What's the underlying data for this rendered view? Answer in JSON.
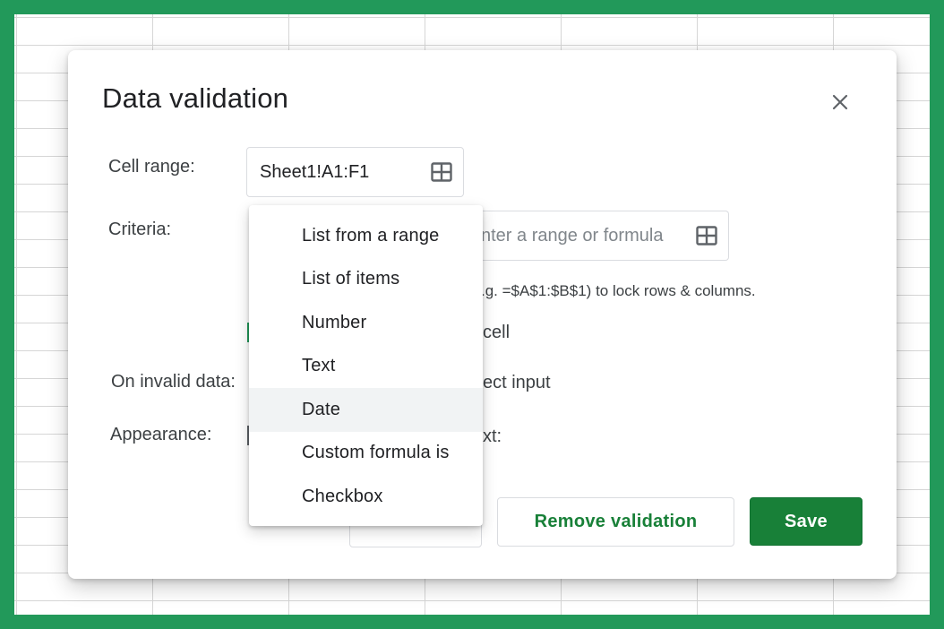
{
  "dialog": {
    "title": "Data validation",
    "close_icon": "close-icon"
  },
  "cell_range": {
    "label": "Cell range:",
    "value": "Sheet1!A1:F1",
    "icon": "grid-select-icon"
  },
  "criteria": {
    "label": "Criteria:",
    "placeholder_visible": "nter a range or formula",
    "icon": "grid-select-icon",
    "hint_visible": ".g. =$A$1:$B$1) to lock rows & columns.",
    "checkbox_text_visible": "cell"
  },
  "on_invalid": {
    "label": "On invalid data:",
    "option_text_visible": "ect input"
  },
  "appearance": {
    "label": "Appearance:",
    "option_text_visible": "xt:"
  },
  "criteria_menu": {
    "items": [
      {
        "label": "List from a range"
      },
      {
        "label": "List of items"
      },
      {
        "label": "Number"
      },
      {
        "label": "Text"
      },
      {
        "label": "Date"
      },
      {
        "label": "Custom formula is"
      },
      {
        "label": "Checkbox"
      }
    ],
    "highlighted": "Date"
  },
  "buttons": {
    "remove_label": "Remove validation",
    "save_label": "Save"
  },
  "colors": {
    "frame": "#22995a",
    "primary": "#188038",
    "menu_highlight": "#f1f3f4"
  }
}
